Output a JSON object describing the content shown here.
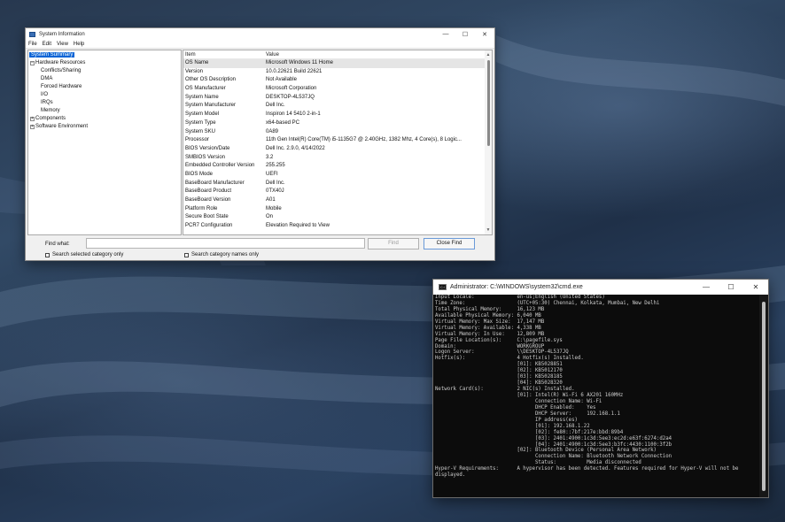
{
  "sysinfo": {
    "title": "System Information",
    "menu": [
      "File",
      "Edit",
      "View",
      "Help"
    ],
    "tree": [
      {
        "label": "System Summary",
        "level": 0,
        "selected": true,
        "expander": ""
      },
      {
        "label": "Hardware Resources",
        "level": 0,
        "selected": false,
        "expander": "−"
      },
      {
        "label": "Conflicts/Sharing",
        "level": 1,
        "selected": false,
        "expander": ""
      },
      {
        "label": "DMA",
        "level": 1,
        "selected": false,
        "expander": ""
      },
      {
        "label": "Forced Hardware",
        "level": 1,
        "selected": false,
        "expander": ""
      },
      {
        "label": "I/O",
        "level": 1,
        "selected": false,
        "expander": ""
      },
      {
        "label": "IRQs",
        "level": 1,
        "selected": false,
        "expander": ""
      },
      {
        "label": "Memory",
        "level": 1,
        "selected": false,
        "expander": ""
      },
      {
        "label": "Components",
        "level": 0,
        "selected": false,
        "expander": "+"
      },
      {
        "label": "Software Environment",
        "level": 0,
        "selected": false,
        "expander": "+"
      }
    ],
    "columns": {
      "item": "Item",
      "value": "Value"
    },
    "rows": [
      {
        "item": "OS Name",
        "value": "Microsoft Windows 11 Home"
      },
      {
        "item": "Version",
        "value": "10.0.22621 Build 22621"
      },
      {
        "item": "Other OS Description",
        "value": "Not Available"
      },
      {
        "item": "OS Manufacturer",
        "value": "Microsoft Corporation"
      },
      {
        "item": "System Name",
        "value": "DESKTOP-4L537JQ"
      },
      {
        "item": "System Manufacturer",
        "value": "Dell Inc."
      },
      {
        "item": "System Model",
        "value": "Inspiron 14 5410 2-in-1"
      },
      {
        "item": "System Type",
        "value": "x64-based PC"
      },
      {
        "item": "System SKU",
        "value": "0A89"
      },
      {
        "item": "Processor",
        "value": "11th Gen Intel(R) Core(TM) i5-1135G7 @ 2.40GHz, 1382 Mhz, 4 Core(s), 8 Logic..."
      },
      {
        "item": "BIOS Version/Date",
        "value": "Dell Inc. 2.9.0, 4/14/2022"
      },
      {
        "item": "SMBIOS Version",
        "value": "3.2"
      },
      {
        "item": "Embedded Controller Version",
        "value": "255.255"
      },
      {
        "item": "BIOS Mode",
        "value": "UEFI"
      },
      {
        "item": "BaseBoard Manufacturer",
        "value": "Dell Inc."
      },
      {
        "item": "BaseBoard Product",
        "value": "0TX40J"
      },
      {
        "item": "BaseBoard Version",
        "value": "A01"
      },
      {
        "item": "Platform Role",
        "value": "Mobile"
      },
      {
        "item": "Secure Boot State",
        "value": "On"
      },
      {
        "item": "PCR7 Configuration",
        "value": "Elevation Required to View"
      }
    ],
    "find": {
      "label": "Find what:",
      "value": "",
      "find_button": "Find",
      "close_button": "Close Find",
      "search_selected_label": "Search selected category only",
      "search_names_label": "Search category names only"
    }
  },
  "cmd": {
    "title": "Administrator: C:\\WINDOWS\\system32\\cmd.exe",
    "lines": [
      "Input Locale:              en-us;English (United States)",
      "Time Zone:                 (UTC+05:30) Chennai, Kolkata, Mumbai, New Delhi",
      "Total Physical Memory:     16,123 MB",
      "Available Physical Memory: 6,040 MB",
      "Virtual Memory: Max Size:  17,147 MB",
      "Virtual Memory: Available: 4,338 MB",
      "Virtual Memory: In Use:    12,809 MB",
      "Page File Location(s):     C:\\pagefile.sys",
      "Domain:                    WORKGROUP",
      "Logon Server:              \\\\DESKTOP-4L537JQ",
      "Hotfix(s):                 4 Hotfix(s) Installed.",
      "                           [01]: KB5028851",
      "                           [02]: KB5012170",
      "                           [03]: KB5028185",
      "                           [04]: KB5028320",
      "Network Card(s):           2 NIC(s) Installed.",
      "                           [01]: Intel(R) Wi-Fi 6 AX201 160MHz",
      "                                 Connection Name: Wi-Fi",
      "                                 DHCP Enabled:    Yes",
      "                                 DHCP Server:     192.168.1.1",
      "                                 IP address(es)",
      "                                 [01]: 192.168.1.22",
      "                                 [02]: fe80::7bf:217e:bbd:89b4",
      "                                 [03]: 2401:4900:1c3d:5ee3:ec2d:e63f:6274:d2a4",
      "                                 [04]: 2401:4900:1c3d:5ee3:b3fc:4430:1100:3f2b",
      "                           [02]: Bluetooth Device (Personal Area Network)",
      "                                 Connection Name: Bluetooth Network Connection",
      "                                 Status:          Media disconnected",
      "Hyper-V Requirements:      A hypervisor has been detected. Features required for Hyper-V will not be",
      "displayed."
    ]
  }
}
